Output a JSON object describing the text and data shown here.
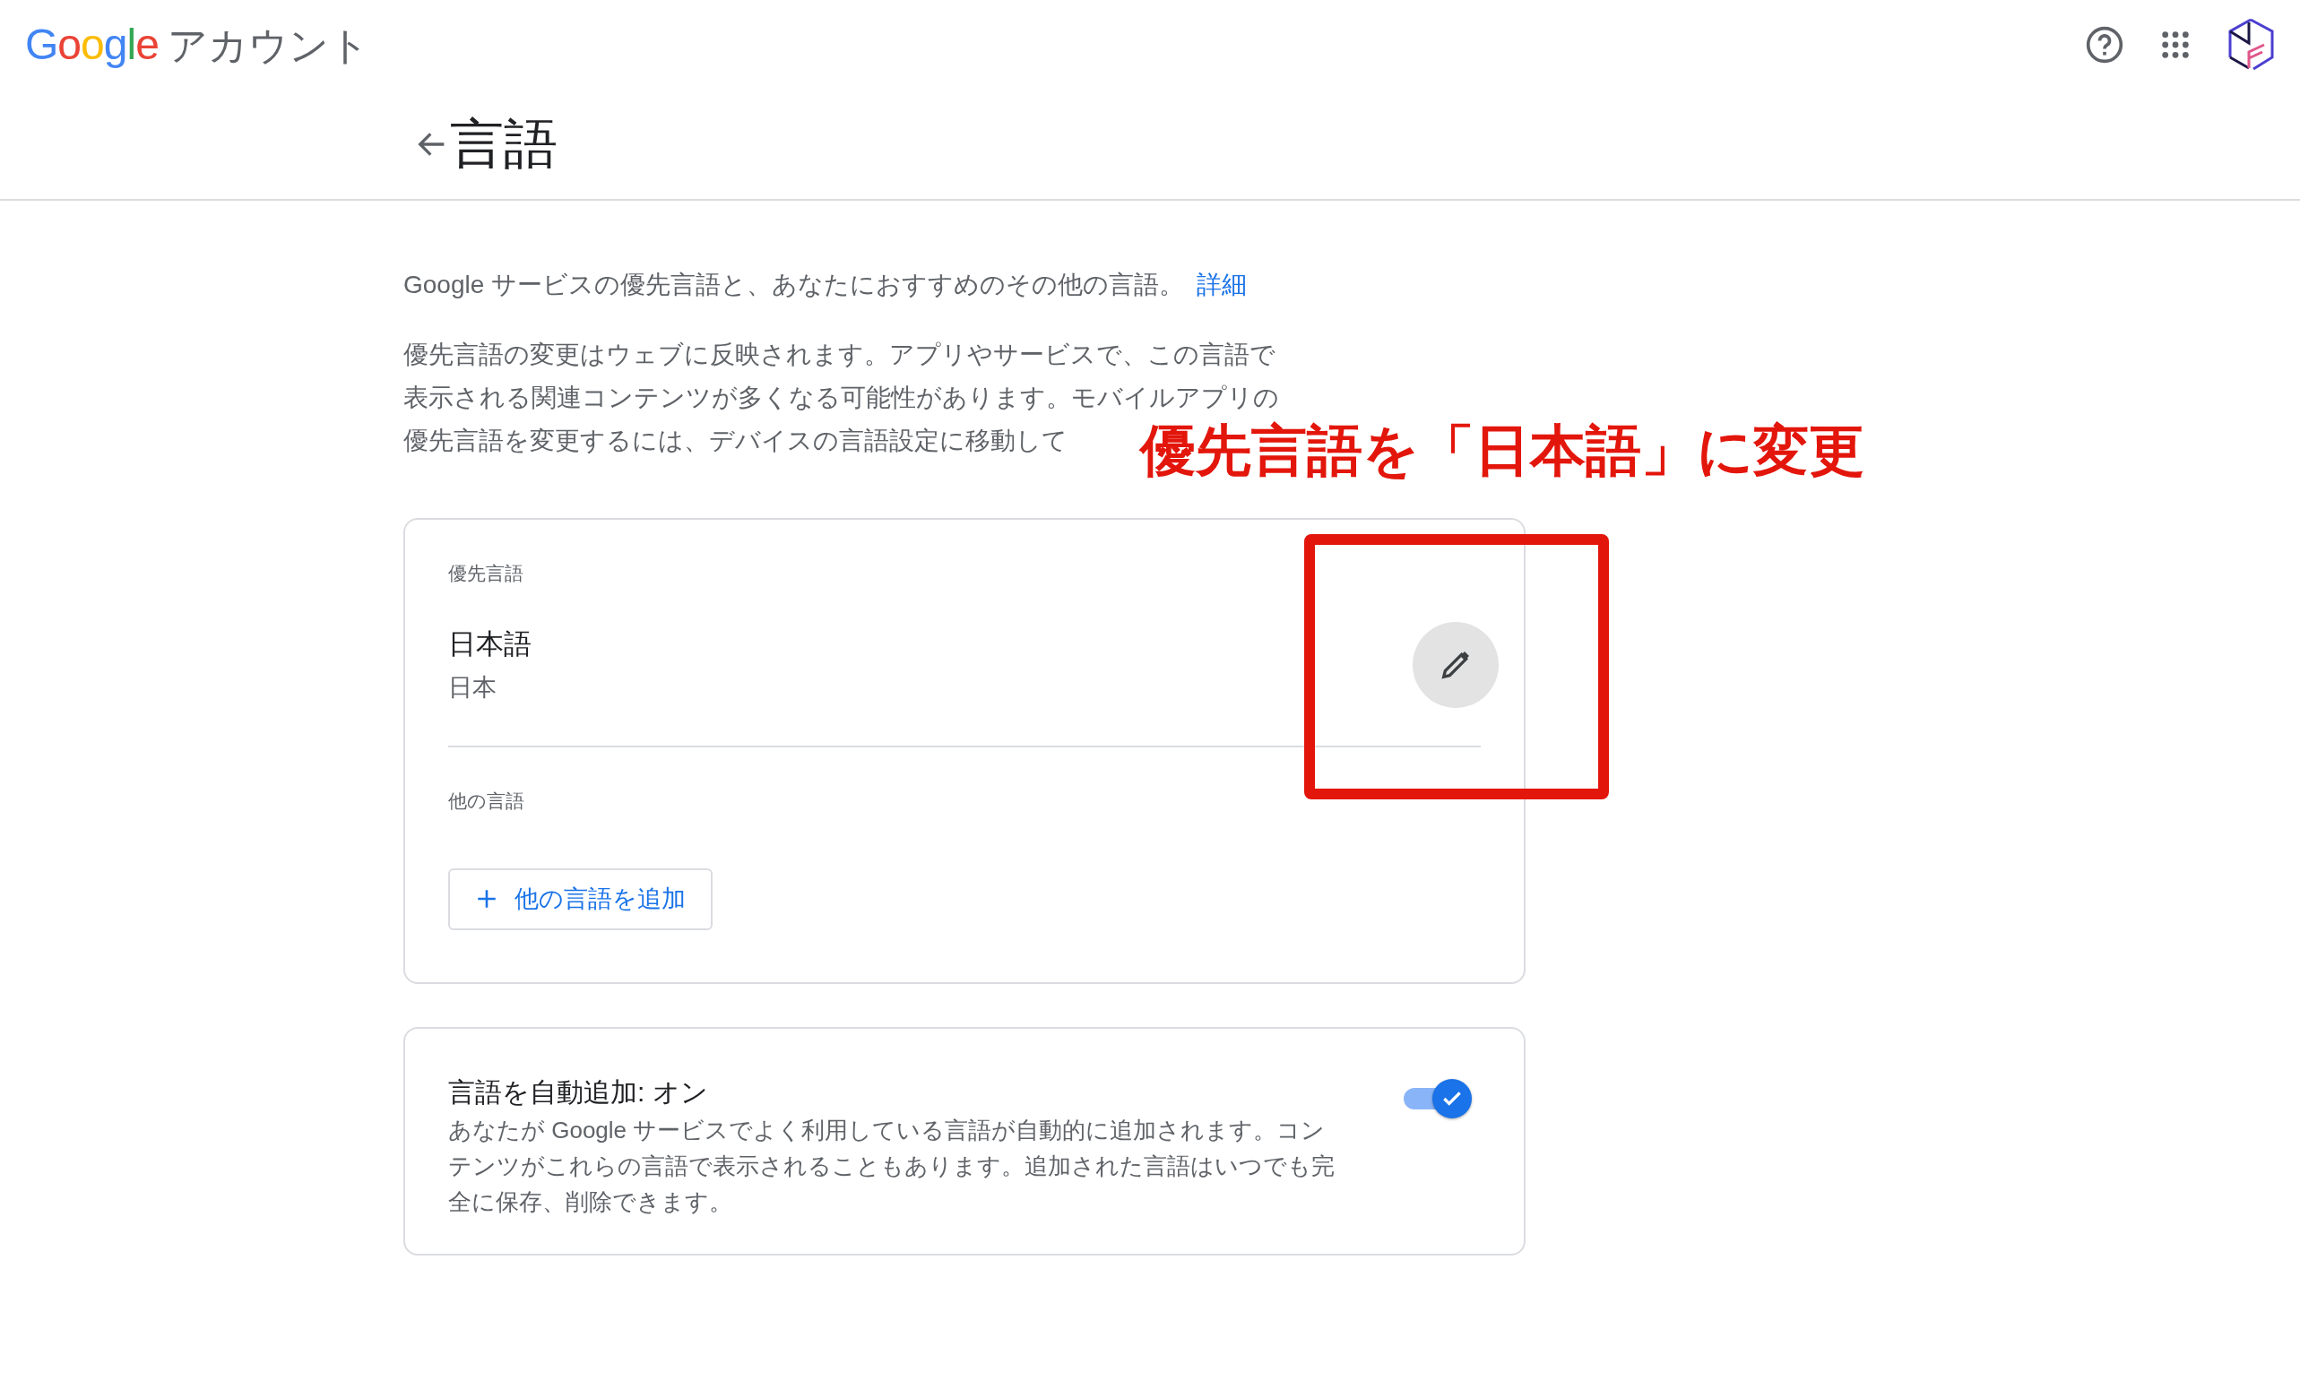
{
  "header": {
    "brand": "Google",
    "product": "アカウント"
  },
  "page": {
    "title": "言語"
  },
  "intro": {
    "text": "Google サービスの優先言語と、あなたにおすすめのその他の言語。",
    "link": "詳細"
  },
  "note": {
    "lines": [
      "優先言語の変更はウェブに反映されます。アプリやサービスで、この言語で",
      "表示される関連コンテンツが多くなる可能性があります。モバイルアプリの",
      "優先言語を変更するには、デバイスの言語設定に移動して"
    ]
  },
  "preferred": {
    "label": "優先言語",
    "language": "日本語",
    "region": "日本"
  },
  "others": {
    "label": "他の言語",
    "add_button": "他の言語を追加"
  },
  "auto_add": {
    "title": "言語を自動追加: オン",
    "description": "あなたが Google サービスでよく利用している言語が自動的に追加されます。コンテンツがこれらの言語で表示されることもあります。追加された言語はいつでも完全に保存、削除できます。",
    "on": true
  },
  "annotation": {
    "text": "優先言語を「日本語」に変更"
  }
}
